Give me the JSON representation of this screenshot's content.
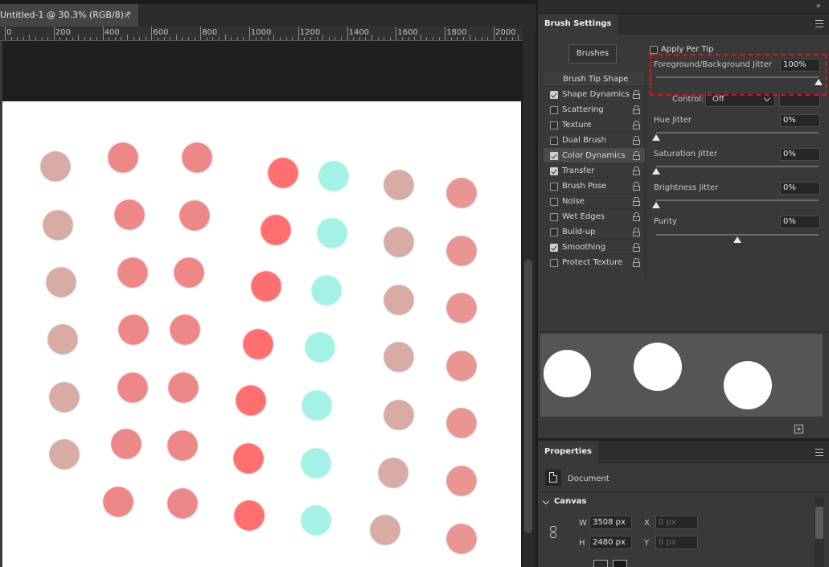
{
  "document_tab": {
    "title": "Untitled-1 @ 30.3% (RGB/8) *",
    "close_glyph": "×"
  },
  "ruler": {
    "labels": [
      "0",
      "200",
      "400",
      "600",
      "800",
      "1000",
      "1200",
      "1400",
      "1600",
      "1800",
      "2000"
    ]
  },
  "canvas": {
    "background": "#ffffff",
    "dot_colors": {
      "tan": "#d6aca5",
      "salmon": "#ee8787",
      "red": "#ff6f6f",
      "cyan": "#a4f2e5",
      "rose": "#e99594"
    }
  },
  "panel_top": {
    "collapse_glyph": "»"
  },
  "brush_settings": {
    "tab_label": "Brush Settings",
    "brushes_button": "Brushes",
    "list_header": "Brush Tip Shape",
    "items": [
      {
        "label": "Shape Dynamics",
        "checked": true
      },
      {
        "label": "Scattering",
        "checked": false
      },
      {
        "label": "Texture",
        "checked": false
      },
      {
        "label": "Dual Brush",
        "checked": false
      },
      {
        "label": "Color Dynamics",
        "checked": true
      },
      {
        "label": "Transfer",
        "checked": true
      },
      {
        "label": "Brush Pose",
        "checked": false
      },
      {
        "label": "Noise",
        "checked": false
      },
      {
        "label": "Wet Edges",
        "checked": false
      },
      {
        "label": "Build-up",
        "checked": false
      },
      {
        "label": "Smoothing",
        "checked": true
      },
      {
        "label": "Protect Texture",
        "checked": false
      }
    ],
    "active_item": "Color Dynamics",
    "apply_per_tip": {
      "label": "Apply Per Tip",
      "checked": false
    },
    "fg_bg_jitter": {
      "label": "Foreground/Background Jitter",
      "value": "100%",
      "level": 1.0
    },
    "control": {
      "label": "Control:",
      "value": "Off"
    },
    "hue_jitter": {
      "label": "Hue Jitter",
      "value": "0%",
      "level": 0.0
    },
    "saturation_jitter": {
      "label": "Saturation Jitter",
      "value": "0%",
      "level": 0.0
    },
    "brightness_jitter": {
      "label": "Brightness Jitter",
      "value": "0%",
      "level": 0.0
    },
    "purity": {
      "label": "Purity",
      "value": "0%",
      "level": 0.5
    },
    "highlight_color": "#d21c1c"
  },
  "properties": {
    "tab_label": "Properties",
    "document_label": "Document",
    "section_title": "Canvas",
    "width": {
      "label": "W",
      "value": "3508 px"
    },
    "height": {
      "label": "H",
      "value": "2480 px"
    },
    "x": {
      "label": "X",
      "placeholder": "0 px"
    },
    "y": {
      "label": "Y",
      "placeholder": "0 px"
    }
  },
  "icons": [
    "close-icon",
    "lock-icon",
    "menu-icon",
    "new-preset-icon",
    "document-icon",
    "link-icon",
    "chevron-down-icon",
    "collapse-icon"
  ]
}
